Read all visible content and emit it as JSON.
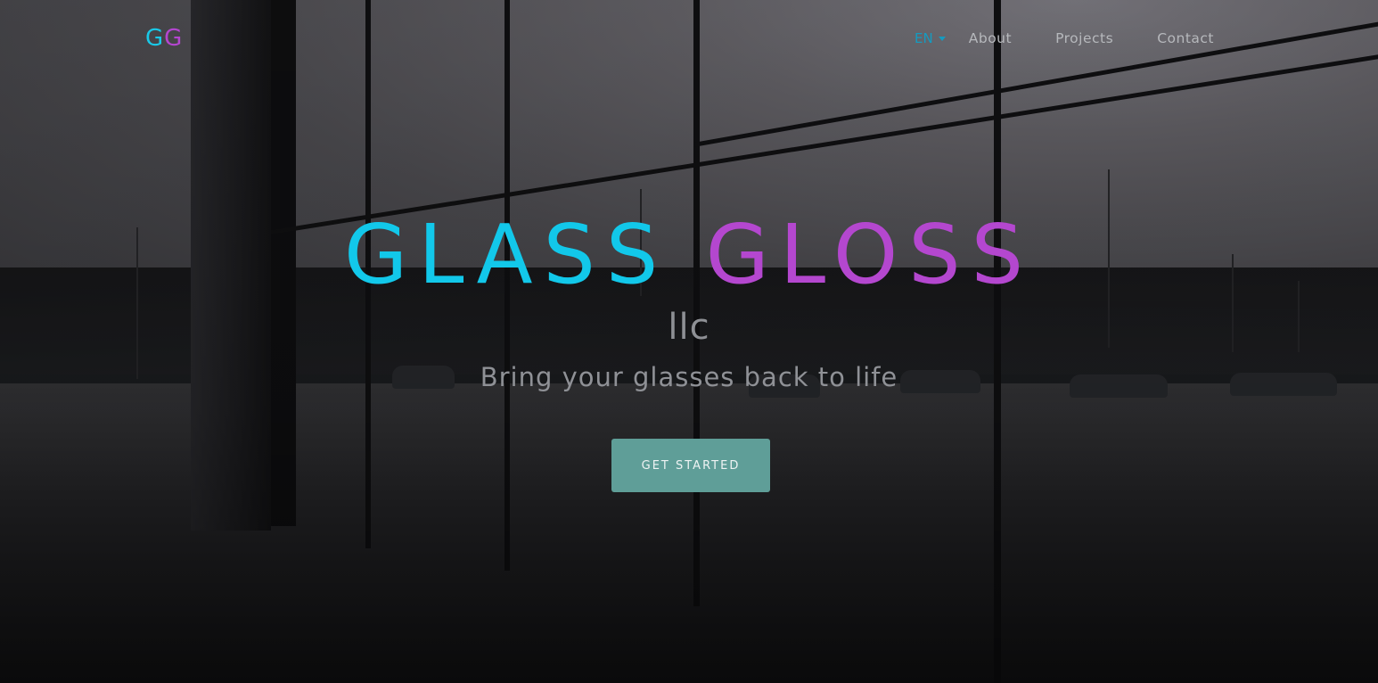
{
  "logo": {
    "letter1": "G",
    "letter2": "G",
    "color1": "#19c9e8",
    "color2": "#b446d0"
  },
  "nav": {
    "language": "EN",
    "links": [
      "About",
      "Projects",
      "Contact"
    ]
  },
  "hero": {
    "title_word1": "GLASS",
    "title_word2": "GLOSS",
    "subtitle": "llc",
    "tagline": "Bring your glasses back to life",
    "cta_label": "GET STARTED",
    "cta_color": "#5f9e98"
  }
}
